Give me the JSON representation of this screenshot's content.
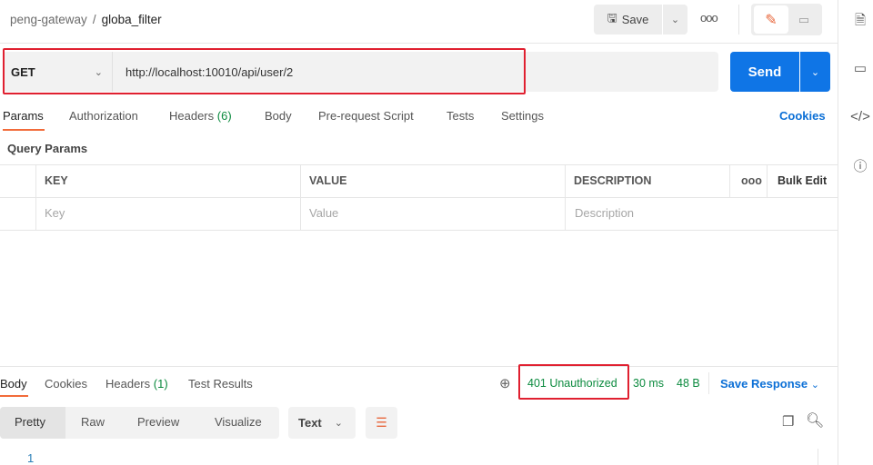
{
  "breadcrumb": {
    "collection": "peng-gateway",
    "separator": "/",
    "request": "globa_filter"
  },
  "toolbar": {
    "save": "Save",
    "more": "ooo"
  },
  "request": {
    "method": "GET",
    "url": "http://localhost:10010/api/user/2",
    "send": "Send"
  },
  "tabs": [
    {
      "label": "Params"
    },
    {
      "label": "Authorization"
    },
    {
      "label": "Headers",
      "count": "(6)"
    },
    {
      "label": "Body"
    },
    {
      "label": "Pre-request Script"
    },
    {
      "label": "Tests"
    },
    {
      "label": "Settings"
    }
  ],
  "cookies": "Cookies",
  "query_params": {
    "title": "Query Params",
    "headers": [
      "KEY",
      "VALUE",
      "DESCRIPTION"
    ],
    "more": "ooo",
    "bulk_edit": "Bulk Edit",
    "placeholders": [
      "Key",
      "Value",
      "Description"
    ]
  },
  "response": {
    "tabs": [
      {
        "label": "Body"
      },
      {
        "label": "Cookies"
      },
      {
        "label": "Headers",
        "count": "(1)"
      },
      {
        "label": "Test Results"
      }
    ],
    "status": "401 Unauthorized",
    "time": "30 ms",
    "size": "48 B",
    "save_response": "Save Response",
    "views": [
      "Pretty",
      "Raw",
      "Preview",
      "Visualize"
    ],
    "format": "Text",
    "line_numbers": [
      "1"
    ]
  },
  "colors": {
    "accent": "#f26b3a",
    "send": "#0f75e6",
    "status": "#0b8a3e",
    "highlight": "#e02030"
  }
}
